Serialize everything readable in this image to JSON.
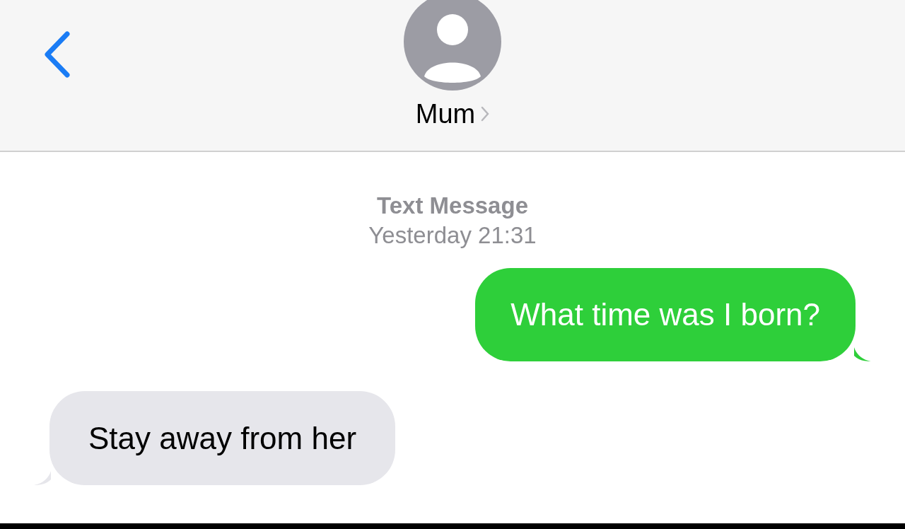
{
  "header": {
    "contact_name": "Mum"
  },
  "thread_info": {
    "service": "Text Message",
    "time": "Yesterday 21:31"
  },
  "messages": [
    {
      "kind": "sent",
      "text": "What time was I born?"
    },
    {
      "kind": "received",
      "text": "Stay away from her"
    }
  ]
}
